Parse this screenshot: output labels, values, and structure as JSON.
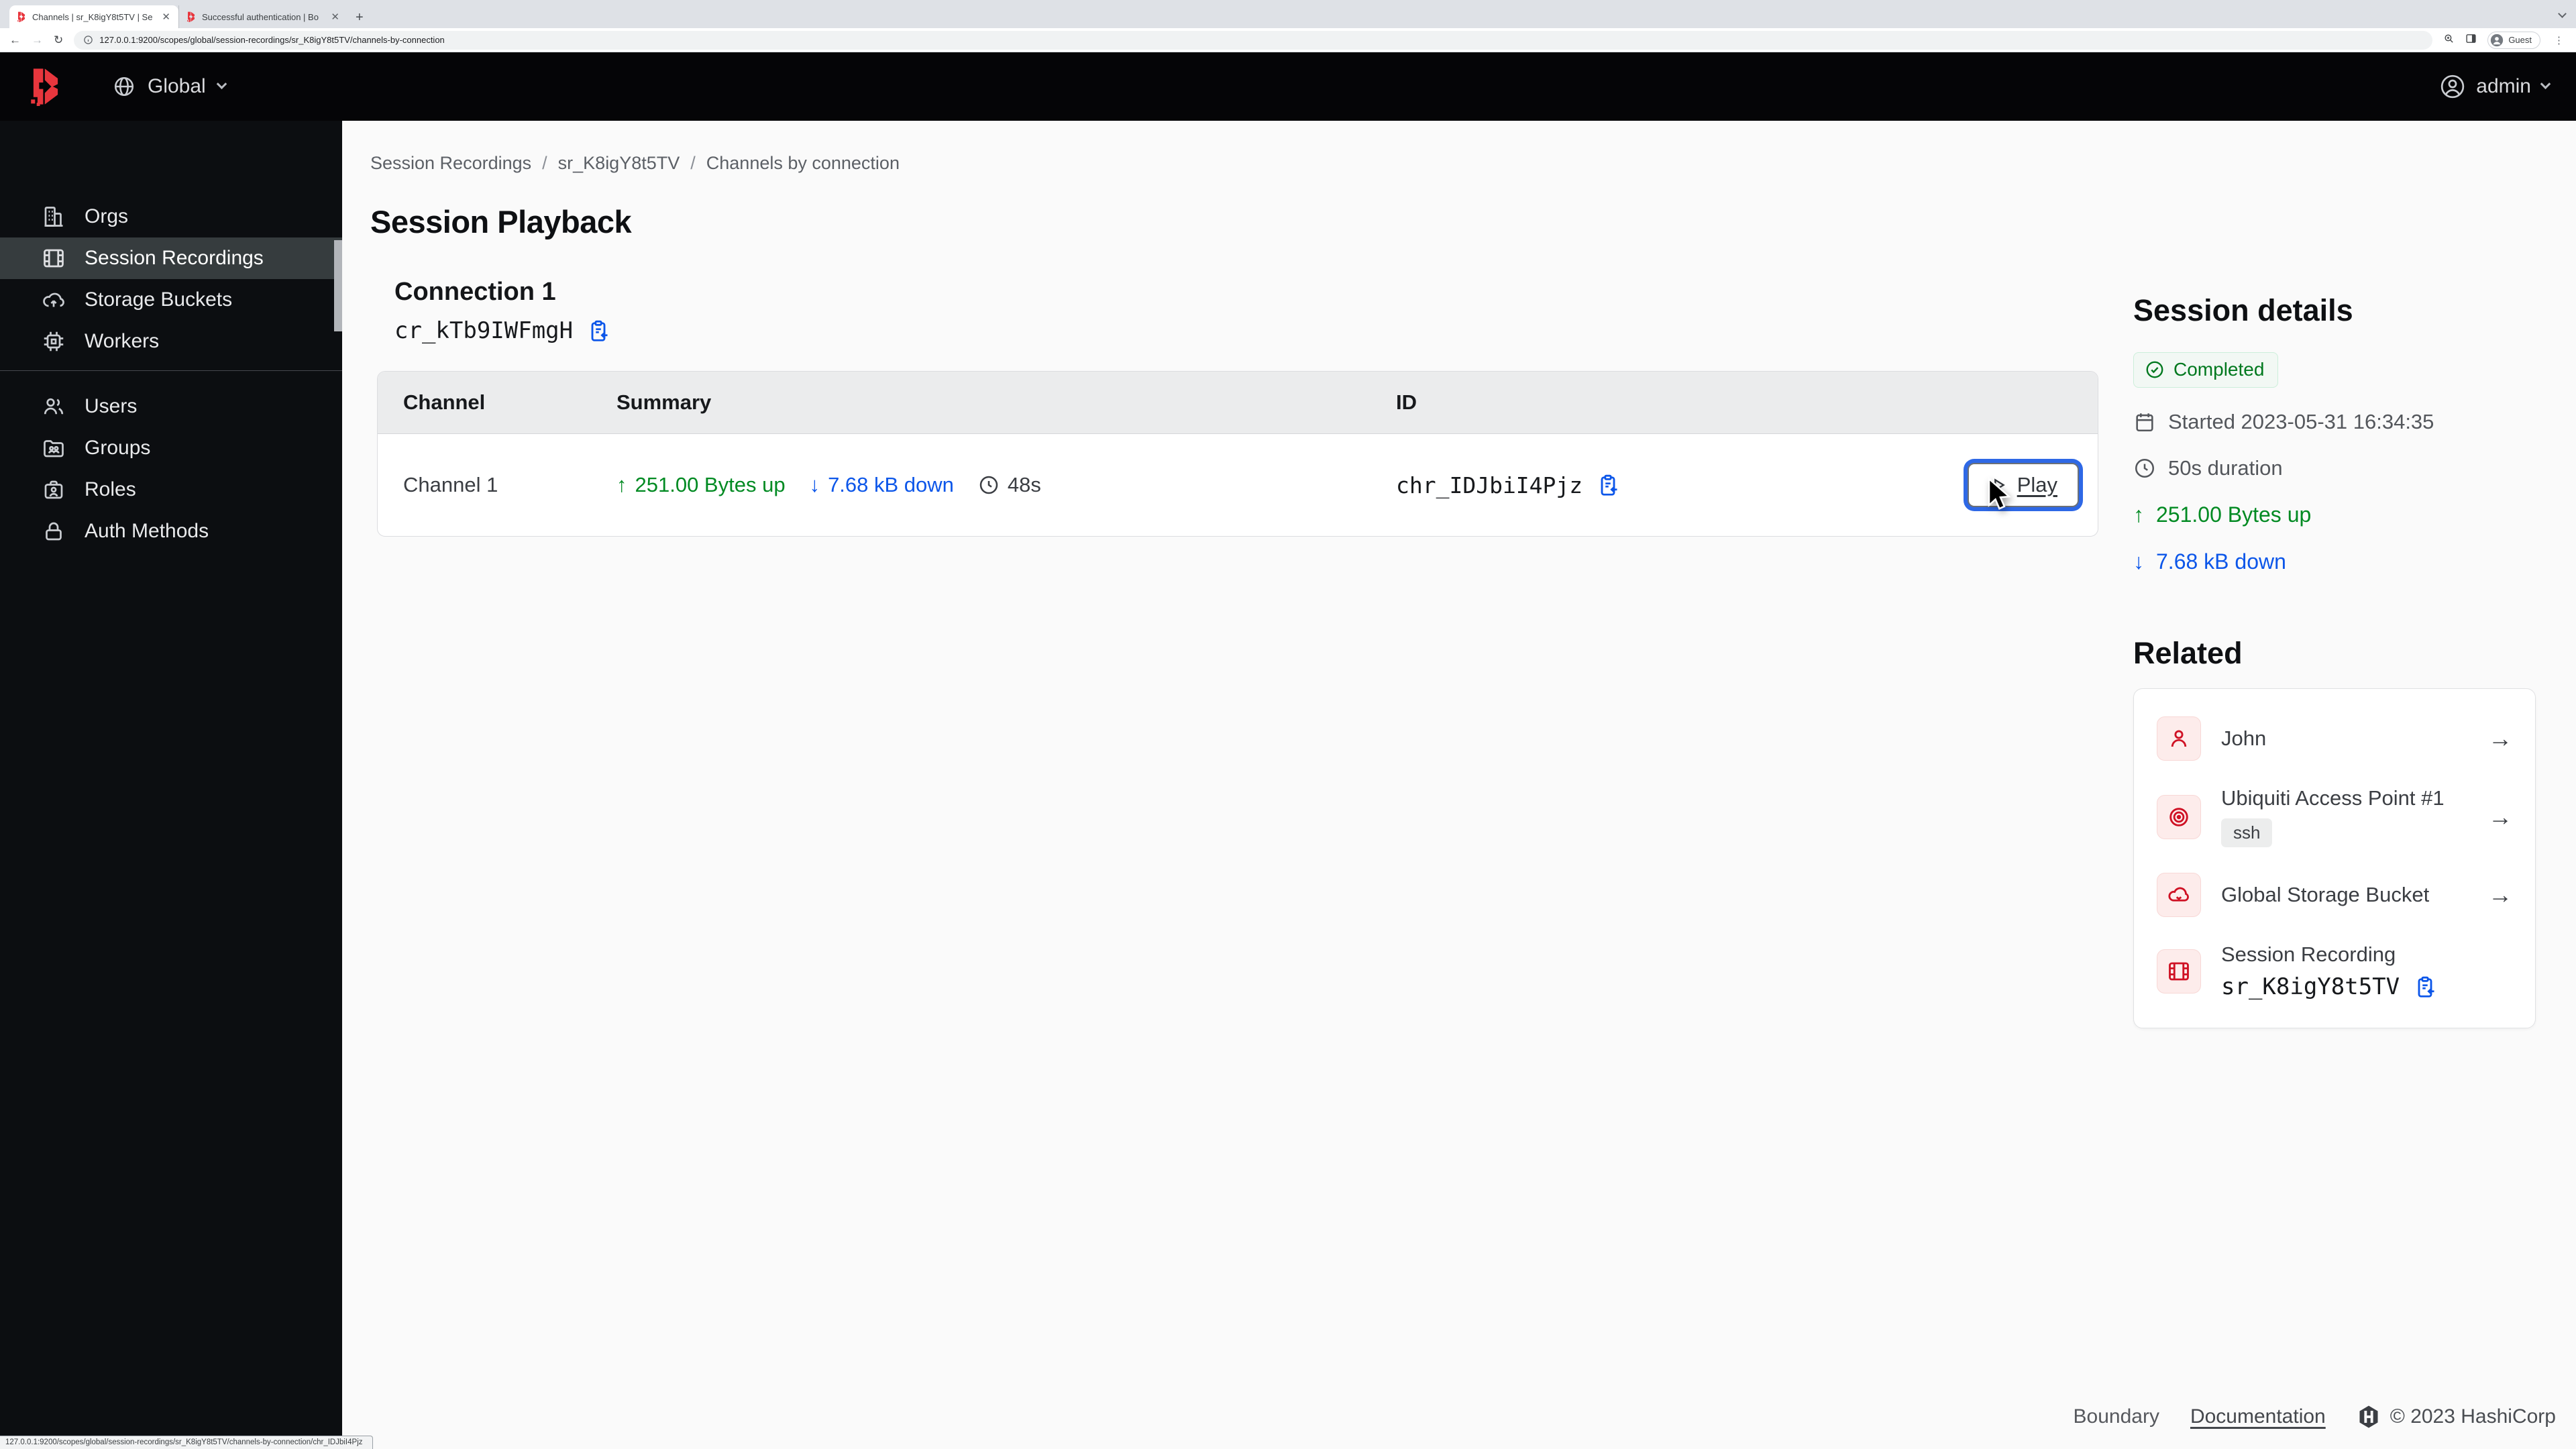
{
  "browser": {
    "tabs": [
      {
        "title": "Channels | sr_K8igY8t5TV | Se"
      },
      {
        "title": "Successful authentication | Bo"
      }
    ],
    "url": "127.0.0.1:9200/scopes/global/session-recordings/sr_K8igY8t5TV/channels-by-connection",
    "profile": "Guest",
    "status_bar_url": "127.0.0.1:9200/scopes/global/session-recordings/sr_K8igY8t5TV/channels-by-connection/chr_IDJbiI4Pjz",
    "glyphs": {
      "close": "✕",
      "plus": "+",
      "back": "←",
      "forward": "→",
      "reload": "↻",
      "kebab": "⋮"
    }
  },
  "header": {
    "scope": "Global",
    "user": "admin"
  },
  "sidebar": {
    "items": [
      {
        "label": "Orgs",
        "icon": "building-icon"
      },
      {
        "label": "Session Recordings",
        "icon": "film-icon"
      },
      {
        "label": "Storage Buckets",
        "icon": "cloud-upload-icon"
      },
      {
        "label": "Workers",
        "icon": "cpu-icon"
      },
      {
        "label": "Users",
        "icon": "users-icon"
      },
      {
        "label": "Groups",
        "icon": "folder-users-icon"
      },
      {
        "label": "Roles",
        "icon": "briefcase-icon"
      },
      {
        "label": "Auth Methods",
        "icon": "lock-icon"
      }
    ]
  },
  "breadcrumb": {
    "items": [
      "Session Recordings",
      "sr_K8igY8t5TV",
      "Channels by connection"
    ],
    "separator": "/"
  },
  "page": {
    "title": "Session Playback"
  },
  "connection": {
    "title": "Connection 1",
    "id": "cr_kTb9IWFmgH"
  },
  "table": {
    "headers": [
      "Channel",
      "Summary",
      "ID"
    ],
    "rows": [
      {
        "channel": "Channel 1",
        "bytes_up": "251.00 Bytes up",
        "bytes_down": "7.68 kB down",
        "duration": "48s",
        "id": "chr_IDJbiI4Pjz",
        "action": "Play"
      }
    ]
  },
  "glyphs": {
    "arrow_up": "↑",
    "arrow_down": "↓",
    "arrow_right": "→"
  },
  "session_details": {
    "title": "Session details",
    "status": "Completed",
    "started": "Started 2023-05-31 16:34:35",
    "duration": "50s duration",
    "bytes_up": "251.00 Bytes up",
    "bytes_down": "7.68 kB down"
  },
  "related": {
    "title": "Related",
    "items": [
      {
        "label": "John",
        "icon": "user-icon"
      },
      {
        "label": "Ubiquiti Access Point #1",
        "badge": "ssh",
        "icon": "target-icon"
      },
      {
        "label": "Global Storage Bucket",
        "icon": "cloud-icon"
      },
      {
        "label": "Session Recording",
        "id": "sr_K8igY8t5TV",
        "icon": "film-icon"
      }
    ]
  },
  "footer": {
    "product": "Boundary",
    "doc_link": "Documentation",
    "copyright": "© 2023 HashiCorp"
  },
  "colors": {
    "accent_blue": "#0c56e9",
    "success_green": "#008a22",
    "brand_red": "#e8363d"
  }
}
